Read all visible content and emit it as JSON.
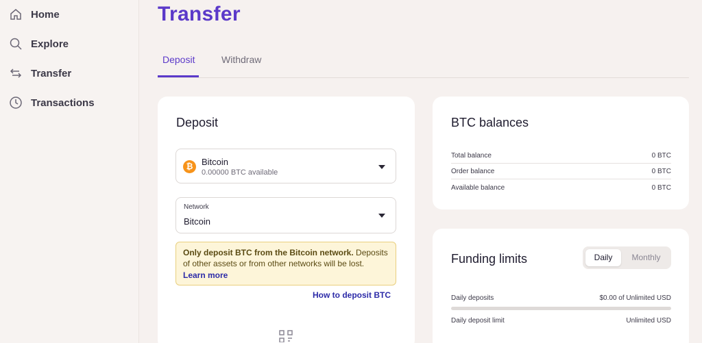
{
  "sidebar": {
    "items": [
      {
        "label": "Home",
        "icon": "home-icon"
      },
      {
        "label": "Explore",
        "icon": "search-icon"
      },
      {
        "label": "Transfer",
        "icon": "transfer-arrows-icon"
      },
      {
        "label": "Transactions",
        "icon": "clock-icon"
      }
    ]
  },
  "page": {
    "title": "Transfer",
    "tabs": [
      {
        "label": "Deposit",
        "active": true
      },
      {
        "label": "Withdraw",
        "active": false
      }
    ]
  },
  "deposit": {
    "title": "Deposit",
    "asset": {
      "name": "Bitcoin",
      "available": "0.00000 BTC available",
      "icon": "bitcoin-icon"
    },
    "network": {
      "label": "Network",
      "value": "Bitcoin"
    },
    "alert": {
      "bold": "Only deposit BTC from the Bitcoin network.",
      "text": " Deposits of other assets or from other networks will be lost.",
      "link": "Learn more"
    },
    "how_to_link": "How to deposit BTC",
    "qr_icon": "qr-code-icon"
  },
  "balances": {
    "title": "BTC balances",
    "rows": [
      {
        "label": "Total balance",
        "value": "0 BTC"
      },
      {
        "label": "Order balance",
        "value": "0 BTC"
      },
      {
        "label": "Available balance",
        "value": "0 BTC"
      }
    ]
  },
  "funding": {
    "title": "Funding limits",
    "toggle": {
      "daily": "Daily",
      "monthly": "Monthly",
      "selected": "Daily"
    },
    "daily_deposits": {
      "label": "Daily deposits",
      "value": "$0.00 of Unlimited USD",
      "progress": 0
    },
    "daily_limit": {
      "label": "Daily deposit limit",
      "value": "Unlimited USD"
    }
  },
  "colors": {
    "accent": "#5b39c9",
    "bitcoin": "#f7931a",
    "alert_bg": "#fdf5d9",
    "link": "#2c2ba8"
  }
}
